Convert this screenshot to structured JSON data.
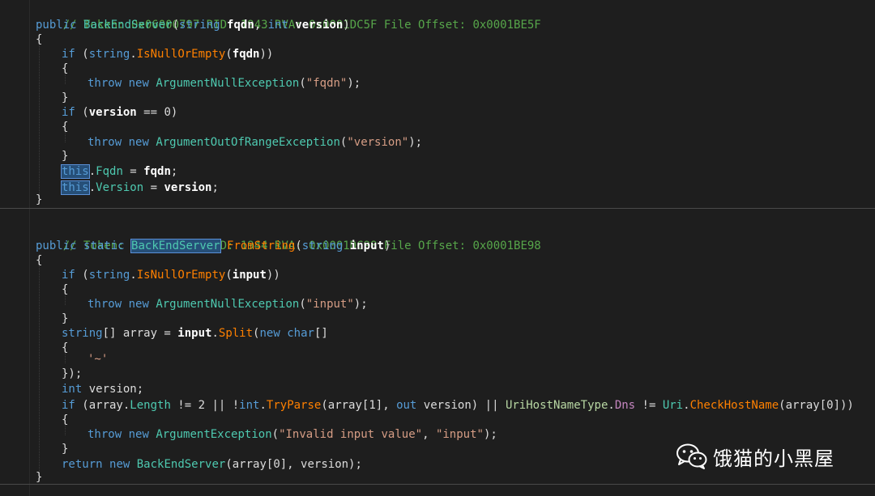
{
  "colors": {
    "background": "#1e1e1e",
    "comment": "#57a64a",
    "keyword": "#569cd6",
    "method": "#ff8000",
    "type": "#4ec9b0",
    "string": "#d69d85",
    "highlight": "#264f78"
  },
  "code": {
    "method1": {
      "comment": "// Token: 0x06000797 RID: 1943 RVA: 0x0001DC5F File Offset: 0x0001BE5F",
      "sig_public": "public",
      "sig_name": "BackEndServer",
      "sig_p1": "string",
      "sig_fqdn": "fqdn",
      "sig_int": "int",
      "sig_version": "version",
      "if1_kw": "if",
      "if1_string": "string",
      "if1_method": "IsNullOrEmpty",
      "if1_arg": "fqdn",
      "throw_kw": "throw",
      "new_kw": "new",
      "ex1_type": "ArgumentNullException",
      "ex1_str": "\"fqdn\"",
      "if2_var": "version",
      "if2_rest": " == 0)",
      "ex2_type": "ArgumentOutOfRangeException",
      "ex2_str": "\"version\"",
      "this_kw": "this",
      "prop_fqdn": "Fqdn",
      "val_fqdn": "fqdn",
      "prop_version": "Version",
      "val_version": "version"
    },
    "method2": {
      "comment": "// Token: 0x06000798 RID: 1944 RVA: 0x0001DC98 File Offset: 0x0001BE98",
      "sig_static": "static",
      "sig_return_type": "BackEndServer",
      "sig_name": "FromString",
      "sig_p1": "string",
      "sig_input": "input",
      "if1_method": "IsNullOrEmpty",
      "if1_arg": "input",
      "ex1_type": "ArgumentNullException",
      "ex1_str": "\"input\"",
      "arr_decl_rest": "[] array = ",
      "arr_input": "input",
      "arr_split": "Split",
      "arr_char": "char",
      "sep_char": "'~'",
      "close_call": "});",
      "int_kw": "int",
      "int_decl_rest": " version;",
      "cond_open": " (array.",
      "cond_length": "Length",
      "cond_mid1": " != 2 || !",
      "cond_tryparse": "TryParse",
      "cond_mid2": "(array[1], ",
      "cond_out": "out",
      "cond_mid3": " version) || ",
      "cond_enumtype": "UriHostNameType",
      "cond_dns": "Dns",
      "cond_uri": "Uri",
      "cond_check": "CheckHostName",
      "cond_tail": "(array[0]))",
      "ex3_type": "ArgumentException",
      "ex3_str1": "\"Invalid input value\"",
      "ex3_str2": "\"input\"",
      "return_kw": "return",
      "return_type": "BackEndServer",
      "return_tail": "(array[0], version);"
    }
  },
  "watermark": {
    "icon": "wechat-icon",
    "text": "饿猫的小黑屋"
  }
}
